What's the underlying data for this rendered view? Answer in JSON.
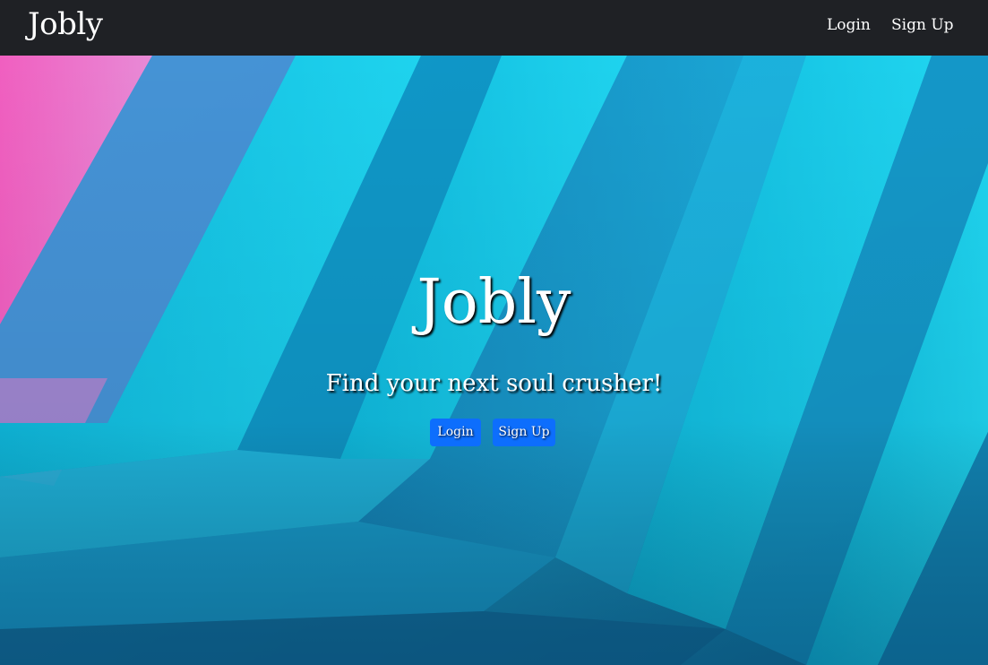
{
  "navbar": {
    "brand": "Jobly",
    "links": {
      "login": "Login",
      "signup": "Sign Up"
    }
  },
  "hero": {
    "title": "Jobly",
    "tagline": "Find your next soul crusher!",
    "buttons": {
      "login": "Login",
      "signup": "Sign Up"
    }
  },
  "colors": {
    "navbar_bg": "#1f2125",
    "button_primary": "#0d6efd",
    "hero_cyan": "#00c6e6",
    "hero_pink": "#f06ac0"
  }
}
